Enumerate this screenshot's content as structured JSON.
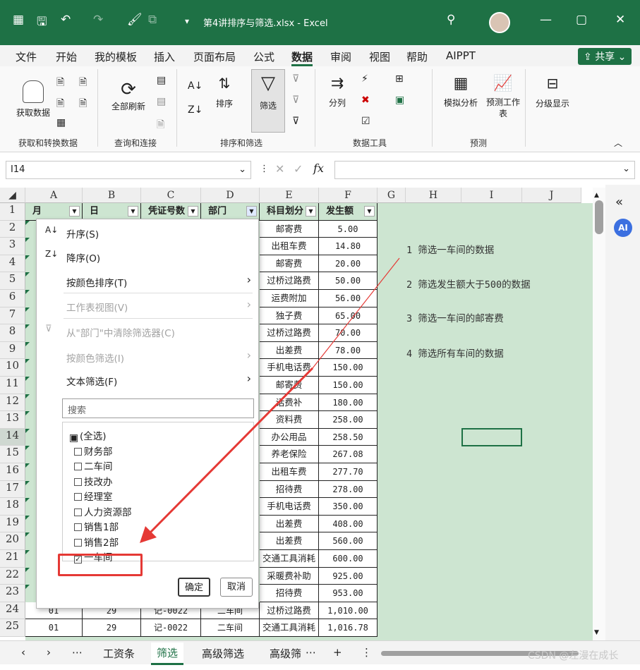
{
  "titlebar": {
    "autosave": "A",
    "filename": "第4讲排序与筛选.xlsx - Excel"
  },
  "menu": [
    "文件",
    "开始",
    "我的模板",
    "插入",
    "页面布局",
    "公式",
    "数据",
    "审阅",
    "视图",
    "帮助",
    "AIPPT"
  ],
  "share_label": "共享",
  "ribbon": {
    "get_data": "获取数据",
    "refresh_all": "全部刷新",
    "sort": "排序",
    "filter": "筛选",
    "split": "分列",
    "what_if": "模拟分析",
    "forecast": "预测工作表",
    "outline": "分级显示",
    "groups": [
      "获取和转换数据",
      "查询和连接",
      "排序和筛选",
      "数据工具",
      "预测"
    ]
  },
  "namebox": "I14",
  "columns": [
    "A",
    "B",
    "C",
    "D",
    "E",
    "F",
    "G",
    "H",
    "I",
    "J"
  ],
  "rows": [
    "1",
    "2",
    "3",
    "4",
    "5",
    "6",
    "7",
    "8",
    "9",
    "10",
    "11",
    "12",
    "13",
    "14",
    "15",
    "16",
    "17",
    "18",
    "19",
    "20",
    "21",
    "22",
    "23",
    "24",
    "25"
  ],
  "headers": [
    "月",
    "日",
    "凭证号数",
    "部门",
    "科目划分",
    "发生额"
  ],
  "categories": [
    "邮寄费",
    "出租车费",
    "邮寄费",
    "过桥过路费",
    "运费附加",
    "独子费",
    "过桥过路费",
    "出差费",
    "手机电话费",
    "邮寄费",
    "话费补",
    "资料费",
    "办公用品",
    "养老保险",
    "出租车费",
    "招待费",
    "手机电话费",
    "出差费",
    "出差费",
    "交通工具消耗",
    "采暖费补助",
    "招待费",
    "过桥过路费",
    "交通工具消耗"
  ],
  "amounts": [
    "5.00",
    "14.80",
    "20.00",
    "50.00",
    "56.00",
    "65.00",
    "70.00",
    "78.00",
    "150.00",
    "150.00",
    "180.00",
    "258.00",
    "258.50",
    "267.08",
    "277.70",
    "278.00",
    "350.00",
    "408.00",
    "560.00",
    "600.00",
    "925.00",
    "953.00",
    "1,010.00",
    "1,016.78"
  ],
  "row24": {
    "month": "01",
    "day": "29",
    "voucher": "记-0022",
    "dept": "二车间"
  },
  "row25": {
    "month": "01",
    "day": "29",
    "voucher": "记-0022",
    "dept": "二车间"
  },
  "notes": [
    "1 筛选一车间的数据",
    "2 筛选发生额大于500的数据",
    "3 筛选一车间的邮寄费",
    "4 筛选所有车间的数据"
  ],
  "filter_menu": {
    "sort_asc": "升序(S)",
    "sort_desc": "降序(O)",
    "sort_color": "按颜色排序(T)",
    "sheet_view": "工作表视图(V)",
    "clear": "从\"部门\"中清除筛选器(C)",
    "filter_color": "按颜色筛选(I)",
    "text_filter": "文本筛选(F)",
    "search_placeholder": "搜索",
    "items": [
      {
        "label": "(全选)",
        "mark": "■"
      },
      {
        "label": "财务部",
        "mark": ""
      },
      {
        "label": "二车间",
        "mark": ""
      },
      {
        "label": "技改办",
        "mark": ""
      },
      {
        "label": "经理室",
        "mark": ""
      },
      {
        "label": "人力资源部",
        "mark": ""
      },
      {
        "label": "销售1部",
        "mark": ""
      },
      {
        "label": "销售2部",
        "mark": ""
      },
      {
        "label": "一车间",
        "mark": "✓"
      }
    ],
    "ok": "确定",
    "cancel": "取消"
  },
  "sheets": [
    "工资条",
    "筛选",
    "高级筛选",
    "高级筛"
  ],
  "watermark": "CSDN @左漫在成长",
  "colors": {
    "excel_green": "#1e7145",
    "cell_green": "#cde5d1",
    "annotation_red": "#e53935"
  }
}
